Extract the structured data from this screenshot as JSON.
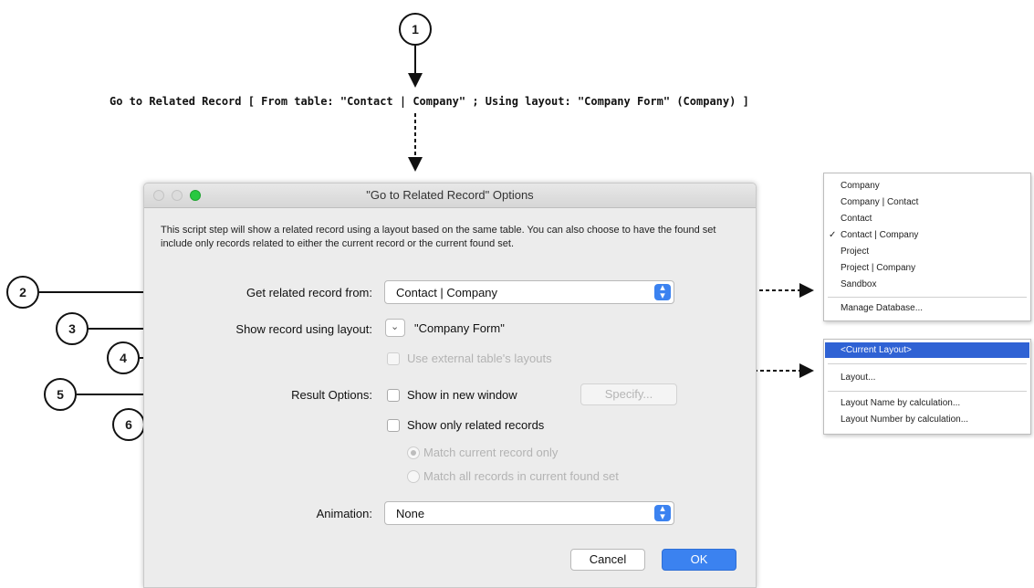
{
  "callouts": [
    "1",
    "2",
    "3",
    "4",
    "5",
    "6"
  ],
  "script_step": "Go to Related Record [ From table: \"Contact | Company\" ; Using layout: \"Company Form\" (Company) ]",
  "dialog": {
    "title": "\"Go to Related Record\" Options",
    "description": "This script step will show a related record using a layout based on the same table.  You can also choose to have the found set include only records related to either the current record or the current found set.",
    "get_related_label": "Get related record from:",
    "get_related_value": "Contact | Company",
    "show_layout_label": "Show record using layout:",
    "show_layout_value": "\"Company Form\"",
    "external_layouts": "Use external table's layouts",
    "result_options_label": "Result Options:",
    "new_window": "Show in new window",
    "specify_button": "Specify...",
    "only_related": "Show only related records",
    "match_current": "Match current record only",
    "match_all": "Match all records in current found set",
    "animation_label": "Animation:",
    "animation_value": "None",
    "cancel_button": "Cancel",
    "ok_button": "OK"
  },
  "table_menu": {
    "items": [
      "Company",
      "Company | Contact",
      "Contact",
      "Contact | Company",
      "Project",
      "Project | Company",
      "Sandbox"
    ],
    "checked": "Contact | Company",
    "checkmark": "✓",
    "manage": "Manage Database..."
  },
  "layout_menu": {
    "selected": "<Current Layout>",
    "layout_item": "Layout...",
    "by_name": "Layout Name by calculation...",
    "by_number": "Layout Number by calculation..."
  },
  "colors": {
    "accent": "#3b82f0",
    "traffic_green": "#28c840"
  }
}
